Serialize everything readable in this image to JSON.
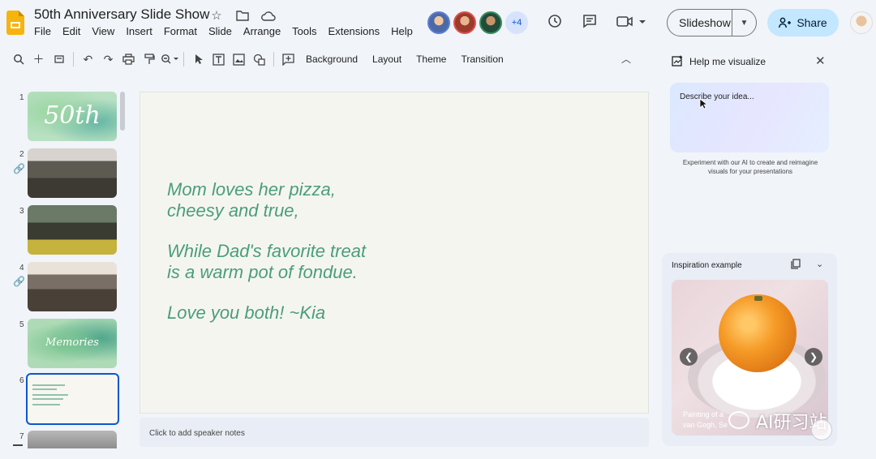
{
  "app": {
    "doc_title": "50th Anniversary Slide Show",
    "brand_color": "#f6b40e",
    "accent_color": "#0b57d0"
  },
  "menu": [
    "File",
    "Edit",
    "View",
    "Insert",
    "Format",
    "Slide",
    "Arrange",
    "Tools",
    "Extensions",
    "Help"
  ],
  "header": {
    "collaborators_more": "+4",
    "slideshow_label": "Slideshow",
    "share_label": "Share"
  },
  "toolbar": {
    "background_label": "Background",
    "layout_label": "Layout",
    "theme_label": "Theme",
    "transition_label": "Transition"
  },
  "filmstrip": {
    "slides": [
      {
        "num": "1",
        "script": "50th"
      },
      {
        "num": "2"
      },
      {
        "num": "3"
      },
      {
        "num": "4"
      },
      {
        "num": "5",
        "script": "Memories"
      },
      {
        "num": "6"
      },
      {
        "num": "7"
      }
    ],
    "selected_slide": "6"
  },
  "slide": {
    "lines": [
      "Mom loves her pizza,",
      "cheesy and true,",
      "While Dad's favorite treat",
      "is a warm pot of fondue.",
      "Love you both! ~Kia"
    ],
    "text_color": "#4a9e7a"
  },
  "notes": {
    "placeholder": "Click to add speaker notes"
  },
  "panel": {
    "title": "Help me visualize",
    "describe_placeholder": "Describe your idea...",
    "experiment_text": "Experiment with our AI to create and reimagine visuals for your presentations",
    "inspiration_title": "Inspiration example",
    "caption_line1": "Painting of a",
    "caption_line2": "van Gogh, Se"
  },
  "watermark": {
    "text": "AI研习站"
  }
}
